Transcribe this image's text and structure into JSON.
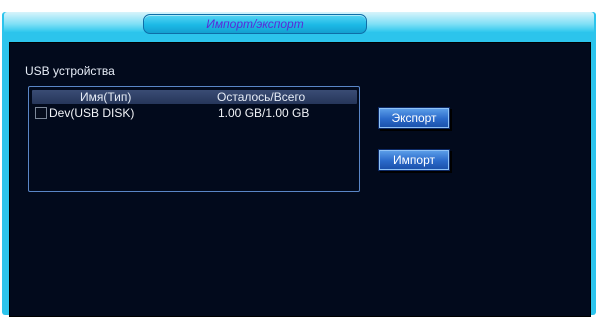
{
  "window": {
    "title": "Импорт/экспорт"
  },
  "usb": {
    "section_label": "USB устройства",
    "columns": [
      "Имя(Тип)",
      "Осталось/Всего"
    ],
    "devices": [
      {
        "name": "Dev(USB DISK)",
        "space": "1.00 GB/1.00 GB",
        "checked": false
      }
    ]
  },
  "actions": {
    "export_label": "Экспорт",
    "import_label": "Импорт"
  },
  "colors": {
    "frame": "#2cc4ec",
    "content_bg": "#020a1c",
    "button": "#2a69c9",
    "title_text": "#5a2bd8"
  }
}
